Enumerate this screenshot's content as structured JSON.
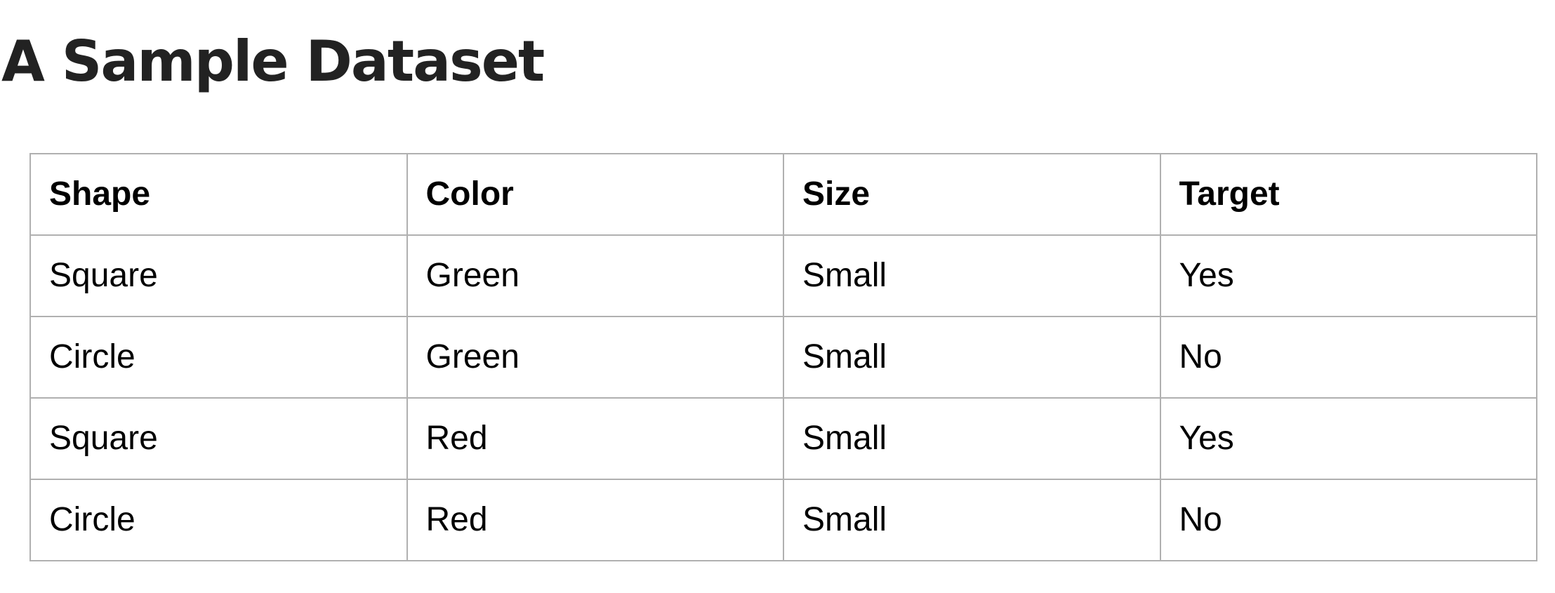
{
  "page": {
    "title": "A Sample Dataset"
  },
  "table": {
    "headers": [
      "Shape",
      "Color",
      "Size",
      "Target"
    ],
    "rows": [
      [
        "Square",
        "Green",
        "Small",
        "Yes"
      ],
      [
        "Circle",
        "Green",
        "Small",
        "No"
      ],
      [
        "Square",
        "Red",
        "Small",
        "Yes"
      ],
      [
        "Circle",
        "Red",
        "Small",
        "No"
      ]
    ]
  },
  "colors": {
    "title_text": "#222222",
    "table_text": "#000000",
    "table_border": "#b0b0b0",
    "background": "#ffffff"
  }
}
